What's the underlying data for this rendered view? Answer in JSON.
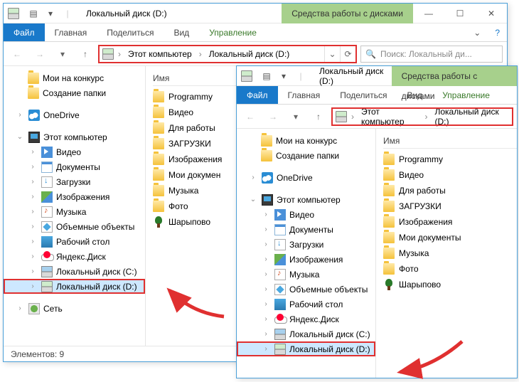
{
  "win1": {
    "title": "Локальный диск (D:)",
    "tools_title": "Средства работы с дисками",
    "tabs": {
      "file": "Файл",
      "home": "Главная",
      "share": "Поделиться",
      "view": "Вид",
      "manage": "Управление"
    },
    "crumbs": {
      "pc": "Этот компьютер",
      "drive": "Локальный диск (D:)"
    },
    "search_placeholder": "Поиск: Локальный ди...",
    "nav": {
      "quick1": "Мои на конкурс",
      "quick2": "Создание папки",
      "onedrive": "OneDrive",
      "thispc": "Этот компьютер",
      "video": "Видео",
      "docs": "Документы",
      "downloads": "Загрузки",
      "images": "Изображения",
      "music": "Музыка",
      "obj3d": "Объемные объекты",
      "desktop": "Рабочий стол",
      "yadisk": "Яндекс.Диск",
      "drivec": "Локальный диск (C:)",
      "drived": "Локальный диск (D:)",
      "network": "Сеть"
    },
    "col_name": "Имя",
    "files": {
      "f1": "Programmy",
      "f2": "Видео",
      "f3": "Для работы",
      "f4": "ЗАГРУЗКИ",
      "f5": "Изображения",
      "f6": "Мои докумен",
      "f7": "Музыка",
      "f8": "Фото",
      "f9": "Шарыпово"
    },
    "status": "Элементов: 9"
  },
  "win2": {
    "title": "Локальный диск (D:)",
    "tools_title": "Средства работы с дисками",
    "tabs": {
      "file": "Файл",
      "home": "Главная",
      "share": "Поделиться",
      "view": "Вид",
      "manage": "Управление"
    },
    "crumbs": {
      "pc": "Этот компьютер",
      "drive": "Локальный диск (D:)"
    },
    "nav": {
      "quick1": "Мои на конкурс",
      "quick2": "Создание папки",
      "onedrive": "OneDrive",
      "thispc": "Этот компьютер",
      "video": "Видео",
      "docs": "Документы",
      "downloads": "Загрузки",
      "images": "Изображения",
      "music": "Музыка",
      "obj3d": "Объемные объекты",
      "desktop": "Рабочий стол",
      "yadisk": "Яндекс.Диск",
      "drivec": "Локальный диск (C:)",
      "drived": "Локальный диск (D:)"
    },
    "col_name": "Имя",
    "files": {
      "f1": "Programmy",
      "f2": "Видео",
      "f3": "Для работы",
      "f4": "ЗАГРУЗКИ",
      "f5": "Изображения",
      "f6": "Мои документы",
      "f7": "Музыка",
      "f8": "Фото",
      "f9": "Шарыпово"
    }
  }
}
